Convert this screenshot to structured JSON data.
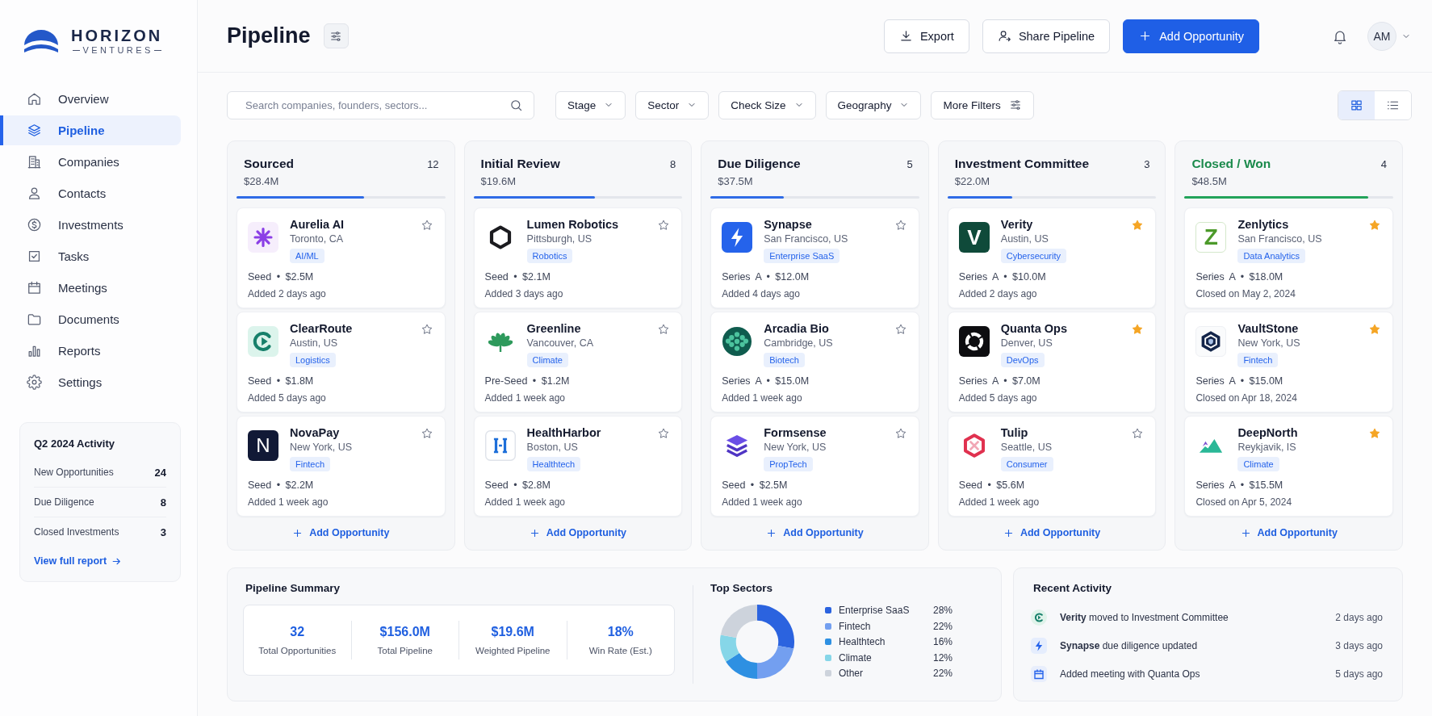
{
  "sidebar": {
    "brand": {
      "name": "HORIZON",
      "tagline": "VENTURES"
    },
    "nav": [
      {
        "label": "Overview",
        "selected": false
      },
      {
        "label": "Pipeline",
        "selected": true
      },
      {
        "label": "Companies",
        "selected": false
      },
      {
        "label": "Contacts",
        "selected": false
      },
      {
        "label": "Investments",
        "selected": false
      },
      {
        "label": "Tasks",
        "selected": false
      },
      {
        "label": "Meetings",
        "selected": false
      },
      {
        "label": "Documents",
        "selected": false
      },
      {
        "label": "Reports",
        "selected": false
      },
      {
        "label": "Settings",
        "selected": false
      }
    ],
    "activity": {
      "title": "Q2 2024 Activity",
      "rows": [
        {
          "label": "New Opportunities",
          "value": "24"
        },
        {
          "label": "Due Diligence",
          "value": "8"
        },
        {
          "label": "Closed Investments",
          "value": "3"
        }
      ],
      "link": "View full report"
    }
  },
  "header": {
    "title": "Pipeline",
    "buttons": [
      {
        "label": "Export",
        "kind": "secondary"
      },
      {
        "label": "Share Pipeline",
        "kind": "secondary"
      },
      {
        "label": "Add Opportunity",
        "kind": "primary"
      }
    ],
    "avatar": "AM"
  },
  "filters": {
    "search": {
      "placeholder": "Search companies, founders, sectors..."
    },
    "items": [
      {
        "label": "Stage",
        "kind": "dropdown"
      },
      {
        "label": "Sector",
        "kind": "dropdown"
      },
      {
        "label": "Check Size",
        "kind": "dropdown"
      },
      {
        "label": "Geography",
        "kind": "dropdown"
      },
      {
        "label": "More Filters",
        "kind": "advanced"
      }
    ],
    "views": [
      {
        "selected": true
      },
      {
        "selected": false
      }
    ]
  },
  "board": {
    "columns": [
      {
        "title": "Sourced",
        "count": "12",
        "amount": "$28.4M",
        "level": 0.61,
        "kind": "open",
        "cards": [
          {
            "name": "Aurelia AI",
            "location": "Toronto, CA",
            "tag": "AI/ML",
            "deal": "Seed • $2.5M",
            "date": "Added 2 days ago",
            "starred": false
          },
          {
            "name": "ClearRoute",
            "location": "Austin, US",
            "tag": "Logistics",
            "deal": "Seed • $1.8M",
            "date": "Added 5 days ago",
            "starred": false
          },
          {
            "name": "NovaPay",
            "monogram": "N",
            "location": "New York, US",
            "tag": "Fintech",
            "deal": "Seed • $2.2M",
            "date": "Added 1 week ago",
            "starred": false
          }
        ],
        "add_label": "Add Opportunity"
      },
      {
        "title": "Initial Review",
        "count": "8",
        "amount": "$19.6M",
        "level": 0.58,
        "kind": "open",
        "cards": [
          {
            "name": "Lumen Robotics",
            "location": "Pittsburgh, US",
            "tag": "Robotics",
            "deal": "Seed • $2.1M",
            "date": "Added 3 days ago",
            "starred": false
          },
          {
            "name": "Greenline",
            "location": "Vancouver, CA",
            "tag": "Climate",
            "deal": "Pre-Seed • $1.2M",
            "date": "Added 1 week ago",
            "starred": false
          },
          {
            "name": "HealthHarbor",
            "location": "Boston, US",
            "tag": "Healthtech",
            "deal": "Seed • $2.8M",
            "date": "Added 1 week ago",
            "starred": false
          }
        ],
        "add_label": "Add Opportunity"
      },
      {
        "title": "Due Diligence",
        "count": "5",
        "amount": "$37.5M",
        "level": 0.35,
        "kind": "open",
        "cards": [
          {
            "name": "Synapse",
            "location": "San Francisco, US",
            "tag": "Enterprise SaaS",
            "deal": "Series A • $12.0M",
            "date": "Added 4 days ago",
            "starred": false
          },
          {
            "name": "Arcadia Bio",
            "location": "Cambridge, US",
            "tag": "Biotech",
            "deal": "Series A • $15.0M",
            "date": "Added 1 week ago",
            "starred": false
          },
          {
            "name": "Formsense",
            "location": "New York, US",
            "tag": "PropTech",
            "deal": "Seed • $2.5M",
            "date": "Added 1 week ago",
            "starred": false
          }
        ],
        "add_label": "Add Opportunity"
      },
      {
        "title": "Investment Committee",
        "count": "3",
        "amount": "$22.0M",
        "level": 0.31,
        "kind": "open",
        "cards": [
          {
            "name": "Verity",
            "monogram": "V",
            "location": "Austin, US",
            "tag": "Cybersecurity",
            "deal": "Series A • $10.0M",
            "date": "Added 2 days ago",
            "starred": true
          },
          {
            "name": "Quanta Ops",
            "location": "Denver, US",
            "tag": "DevOps",
            "deal": "Series A • $7.0M",
            "date": "Added 5 days ago",
            "starred": true
          },
          {
            "name": "Tulip",
            "location": "Seattle, US",
            "tag": "Consumer",
            "deal": "Seed • $5.6M",
            "date": "Added 1 week ago",
            "starred": false
          }
        ],
        "add_label": "Add Opportunity"
      },
      {
        "title": "Closed / Won",
        "count": "4",
        "amount": "$48.5M",
        "level": 0.88,
        "kind": "won",
        "cards": [
          {
            "name": "Zenlytics",
            "monogram": "Z",
            "location": "San Francisco, US",
            "tag": "Data Analytics",
            "deal": "Series A • $18.0M",
            "date": "Closed on May 2, 2024",
            "starred": true
          },
          {
            "name": "VaultStone",
            "location": "New York, US",
            "tag": "Fintech",
            "deal": "Series A • $15.0M",
            "date": "Closed on Apr 18, 2024",
            "starred": true
          },
          {
            "name": "DeepNorth",
            "location": "Reykjavik, IS",
            "tag": "Climate",
            "deal": "Series A • $15.5M",
            "date": "Closed on Apr 5, 2024",
            "starred": true
          }
        ],
        "add_label": "Add Opportunity"
      }
    ]
  },
  "summary": {
    "title": "Pipeline Summary",
    "stats": [
      {
        "value": "32",
        "label": "Total Opportunities"
      },
      {
        "value": "$156.0M",
        "label": "Total Pipeline"
      },
      {
        "value": "$19.6M",
        "label": "Weighted Pipeline"
      },
      {
        "value": "18%",
        "label": "Win Rate (Est.)"
      }
    ]
  },
  "top_sectors": {
    "title": "Top Sectors",
    "chart_data": {
      "type": "donut",
      "categories": [
        "Enterprise SaaS",
        "Fintech",
        "Healthtech",
        "Climate",
        "Other"
      ],
      "values": [
        28,
        22,
        16,
        12,
        22
      ]
    },
    "legend": [
      {
        "color": "#2b63df",
        "share": "28%"
      },
      {
        "color": "#739ff0",
        "share": "22%"
      },
      {
        "color": "#2e90e2",
        "share": "16%"
      },
      {
        "color": "#86d6e8",
        "share": "12%"
      },
      {
        "color": "#cdd3dc",
        "share": "22%"
      }
    ]
  },
  "recent_activity": {
    "title": "Recent Activity",
    "items": [
      {
        "text": "**Verity** moved to Investment Committee",
        "time": "2 days ago"
      },
      {
        "text": "**Synapse** due diligence updated",
        "time": "3 days ago"
      },
      {
        "text": "Added meeting with Quanta Ops",
        "time": "5 days ago"
      }
    ]
  }
}
